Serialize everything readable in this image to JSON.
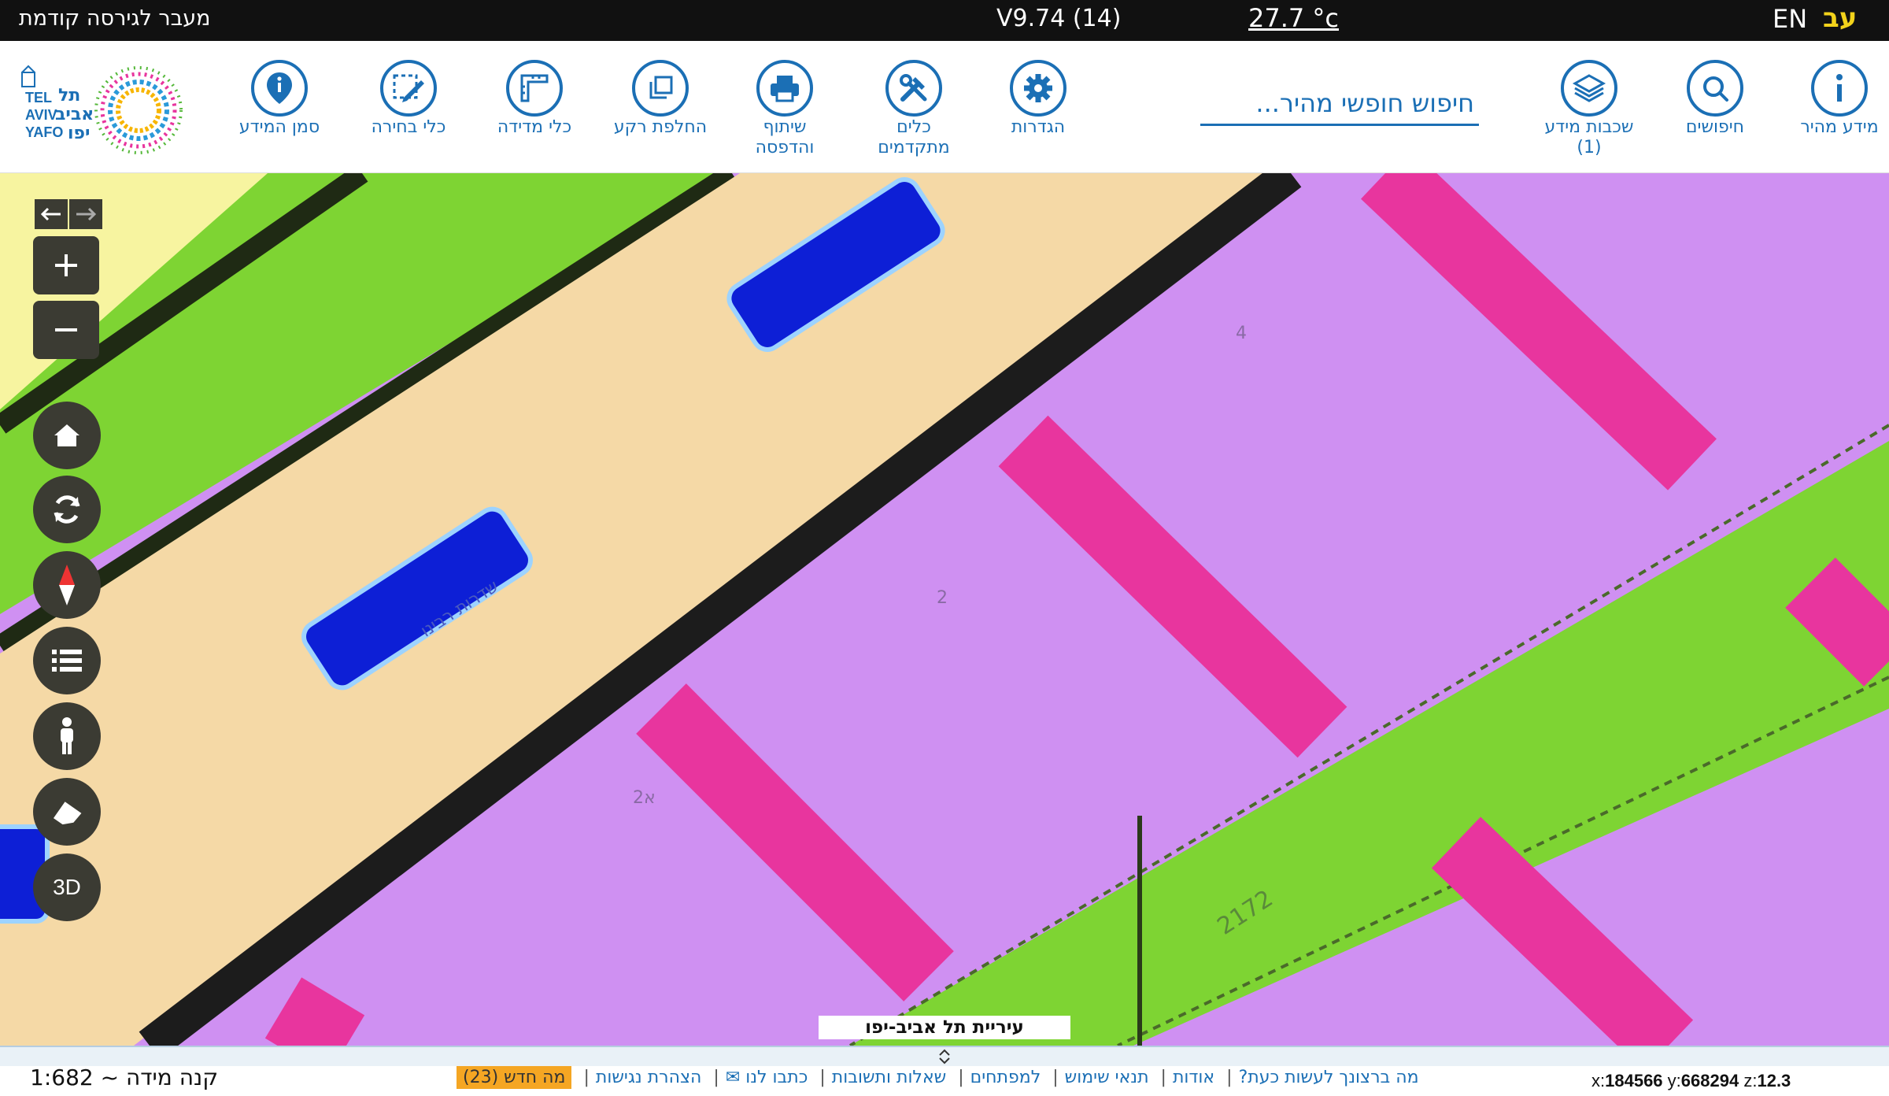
{
  "topbar": {
    "prev_version": "מעבר לגירסה קודמת",
    "version": "V9.74 (14)",
    "temperature": "27.7 °c",
    "lang_en": "EN",
    "lang_he": "עב"
  },
  "toolbar": {
    "info_point": "סמן המידע",
    "select_tools": "כלי בחירה",
    "measure_tools": "כלי מדידה",
    "basemap": "החלפת רקע",
    "share_print_1": "שיתוף",
    "share_print_2": "והדפסה",
    "advanced_1": "כלים",
    "advanced_2": "מתקדמים",
    "settings": "הגדרות",
    "search_placeholder": "חיפוש חופשי מהיר...",
    "layers_1": "שכבות מידע",
    "layers_2": "(1)",
    "searches": "חיפושים",
    "quick_info": "מידע מהיר"
  },
  "logo": {
    "he_1": "תל",
    "he_2": "אביב",
    "he_3": "יפו",
    "en_1": "TEL",
    "en_2": "AVIV",
    "en_3": "YAFO"
  },
  "map": {
    "municipality_label": "עיריית תל אביב-יפו",
    "street_label": "שדרות רבינו",
    "parcel_labels": [
      "4",
      "2",
      "א2",
      "2172"
    ],
    "colors": {
      "residential_purple": "#cf90f2",
      "road_tan": "#f5d9a6",
      "green_strip": "#7ed433",
      "pink_path": "#e8359e",
      "water_blue": "#0d1fd6",
      "rail_black": "#1c1c1c"
    },
    "controls": {
      "three_d": "3D"
    }
  },
  "footer": {
    "scale": "קנה מידה ~ 1:682",
    "links": [
      "מה ברצונך לעשות כעת?",
      "אודות",
      "תנאי שימוש",
      "למפתחים",
      "שאלות ותשובות",
      "כתבו לנו ✉",
      "הצהרת נגישות"
    ],
    "new_badge": "מה חדש (23)",
    "x_label": "x:",
    "x_value": "184566",
    "y_label": "y:",
    "y_value": "668294",
    "z_label": "z:",
    "z_value": "12.3"
  }
}
